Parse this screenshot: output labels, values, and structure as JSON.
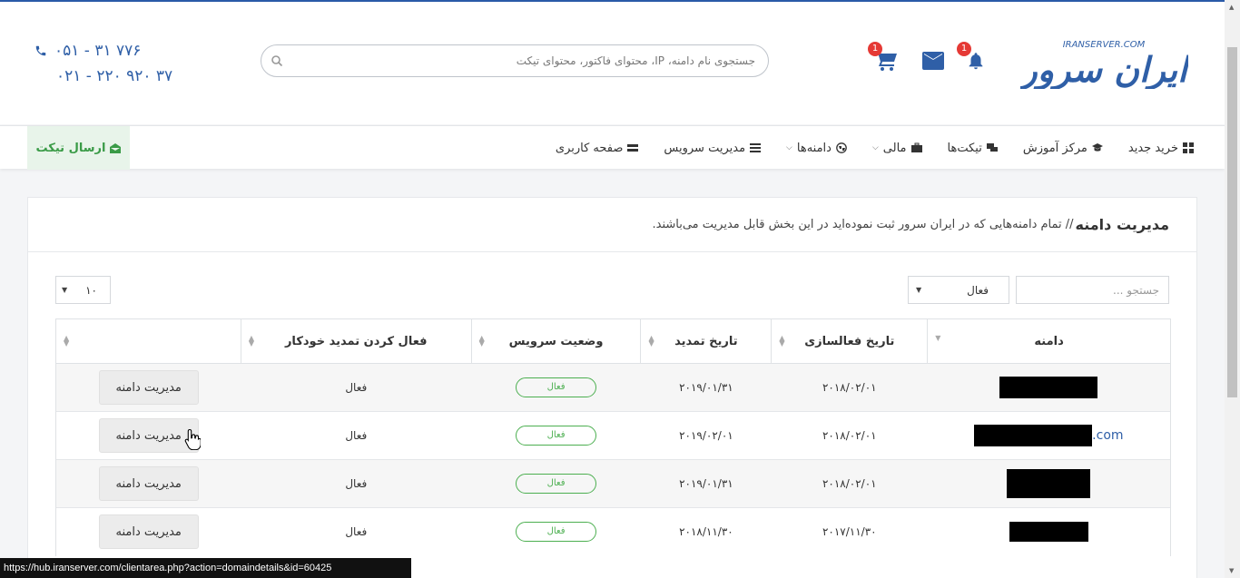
{
  "header": {
    "logo_text": "ایران سرور",
    "logo_subtext": "IRANSERVER.COM",
    "cart_badge": "1",
    "notification_badge": "1",
    "search_placeholder": "جستجوی نام دامنه، IP، محتوای فاکتور، محتوای تیکت",
    "phone1": "۰۵۱ - ۳۱ ۷۷۶",
    "phone2": "۰۲۱ - ۲۲۰ ۹۲۰ ۳۷"
  },
  "nav": {
    "items": [
      {
        "label": "صفحه کاربری",
        "icon": "dashboard-icon"
      },
      {
        "label": "مدیریت سرویس",
        "icon": "list-icon"
      },
      {
        "label": "دامنه‌ها",
        "icon": "globe-icon"
      },
      {
        "label": "مالی",
        "icon": "briefcase-icon"
      },
      {
        "label": "تیکت‌ها",
        "icon": "chat-icon"
      },
      {
        "label": "مرکز آموزش",
        "icon": "graduation-cap-icon"
      },
      {
        "label": "خرید جدید",
        "icon": "grid-icon"
      }
    ],
    "send_ticket": "ارسال تیکت"
  },
  "panel": {
    "title": "مدیریت دامنه",
    "subtitle": "// تمام دامنه‌هایی که در ایران سرور ثبت نموده‌اید در این بخش قابل مدیریت می‌باشند."
  },
  "filters": {
    "search_placeholder": "جستجو ...",
    "status_value": "فعال",
    "page_length": "۱۰"
  },
  "table": {
    "headers": [
      "دامنه",
      "تاریخ فعالسازی",
      "تاریخ تمدید",
      "وضعیت سرویس",
      "فعال کردن تمدید خودکار",
      ""
    ],
    "rows": [
      {
        "domain_suffix": "",
        "activation": "۲۰۱۸/۰۲/۰۱",
        "renewal": "۲۰۱۹/۰۱/۳۱",
        "status": "فعال",
        "autorenew": "فعال",
        "action": "مدیریت دامنه"
      },
      {
        "domain_suffix": ".com",
        "activation": "۲۰۱۸/۰۲/۰۱",
        "renewal": "۲۰۱۹/۰۲/۰۱",
        "status": "فعال",
        "autorenew": "فعال",
        "action": "مدیریت دامنه"
      },
      {
        "domain_suffix": "",
        "activation": "۲۰۱۸/۰۲/۰۱",
        "renewal": "۲۰۱۹/۰۱/۳۱",
        "status": "فعال",
        "autorenew": "فعال",
        "action": "مدیریت دامنه"
      },
      {
        "domain_suffix": "",
        "activation": "۲۰۱۷/۱۱/۳۰",
        "renewal": "۲۰۱۸/۱۱/۳۰",
        "status": "فعال",
        "autorenew": "فعال",
        "action": "مدیریت دامنه"
      }
    ]
  },
  "statusbar": {
    "url": "https://hub.iranserver.com/clientarea.php?action=domaindetails&id=60425"
  },
  "colors": {
    "brand": "#2f5fa7",
    "success": "#4caf50",
    "badge": "#e53935"
  }
}
